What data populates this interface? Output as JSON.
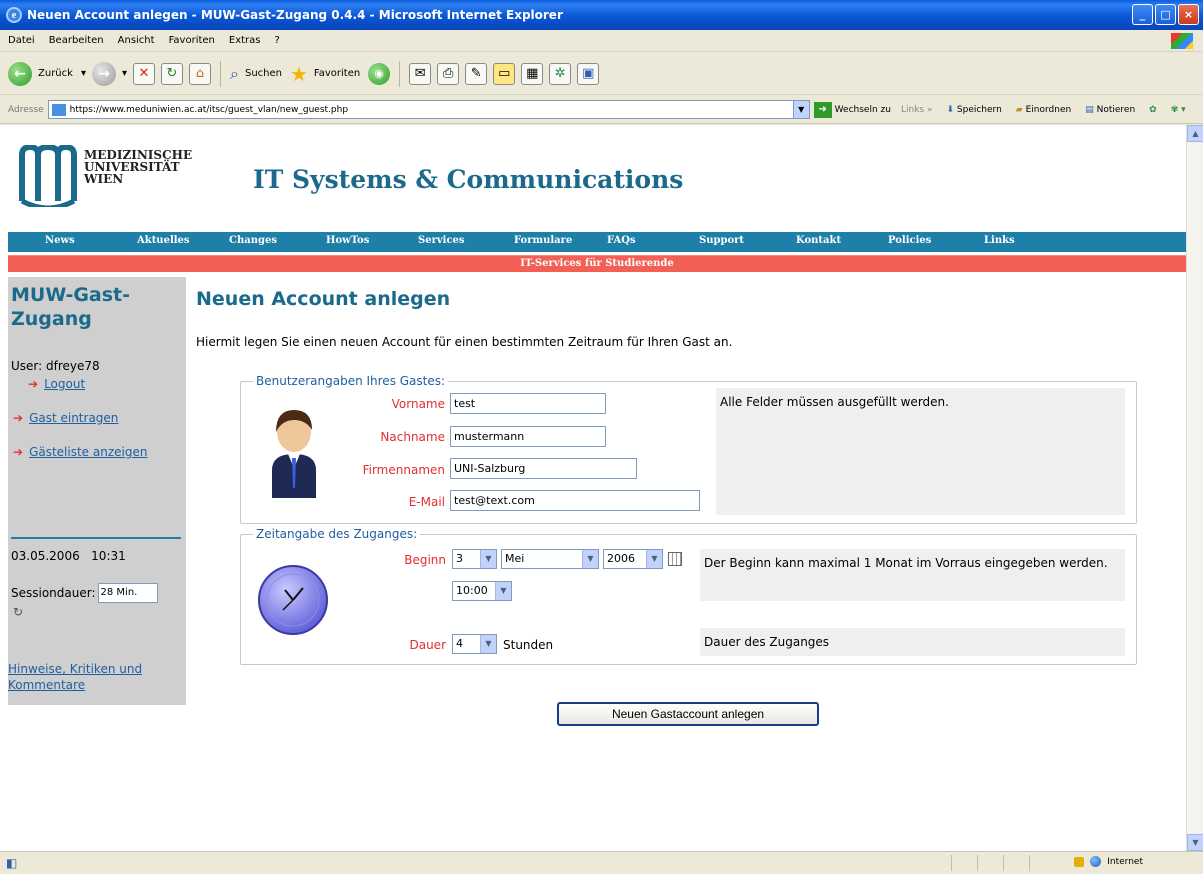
{
  "window": {
    "title": "Neuen Account anlegen - MUW-Gast-Zugang 0.4.4 - Microsoft Internet Explorer",
    "controls": [
      "_",
      "□",
      "×"
    ]
  },
  "menubar": [
    "Datei",
    "Bearbeiten",
    "Ansicht",
    "Favoriten",
    "Extras",
    "?"
  ],
  "toolbar": {
    "back": "Zurück",
    "search": "Suchen",
    "favorites": "Favoriten"
  },
  "addressbar": {
    "label": "Adresse",
    "url": "https://www.meduniwien.ac.at/itsc/guest_vlan/new_guest.php",
    "go": "Wechseln zu",
    "links": "Links",
    "links_chevron": "»",
    "save": "Speichern",
    "sort": "Einordnen",
    "notes": "Notieren"
  },
  "page": {
    "logo_text": [
      "MEDIZINISCHE",
      "UNIVERSITÄT",
      "WIEN"
    ],
    "site_title": "IT Systems & Communications",
    "nav": [
      "News",
      "Aktuelles",
      "Changes",
      "HowTos",
      "Services",
      "Formulare",
      "FAQs",
      "Support",
      "Kontakt",
      "Policies",
      "Links"
    ],
    "subnav": "IT-Services für Studierende",
    "sidebar": {
      "title": "MUW-Gast-Zugang",
      "user": "User: dfreye78",
      "logout": "Logout",
      "add_guest": "Gast eintragen",
      "guest_list": "Gästeliste anzeigen",
      "date": "03.05.2006",
      "time": "10:31",
      "session_label": "Sessiondauer:",
      "session_value": "28 Min.",
      "feedback_1": "Hinweise, Kritiken und",
      "feedback_2": "Kommentare"
    },
    "heading": "Neuen Account anlegen",
    "intro": "Hiermit legen Sie einen neuen Account für einen bestimmten Zeitraum für Ihren Gast an.",
    "user_section": {
      "legend": "Benutzerangaben Ihres Gastes:",
      "firstname_label": "Vorname",
      "firstname_value": "test",
      "lastname_label": "Nachname",
      "lastname_value": "mustermann",
      "company_label": "Firmennamen",
      "company_value": "UNI-Salzburg",
      "email_label": "E-Mail",
      "email_value": "test@text.com",
      "note": "Alle Felder müssen ausgefüllt werden."
    },
    "time_section": {
      "legend": "Zeitangabe des Zuganges:",
      "start_label": "Beginn",
      "day": "3",
      "month": "Mei",
      "year": "2006",
      "hour": "10:00",
      "start_note": "Der Beginn kann maximal 1 Monat im Vorraus eingegeben werden.",
      "duration_label": "Dauer",
      "duration_value": "4",
      "duration_unit": "Stunden",
      "duration_note": "Dauer des Zuganges"
    },
    "submit": "Neuen Gastaccount anlegen"
  },
  "statusbar": {
    "zone": "Internet"
  }
}
